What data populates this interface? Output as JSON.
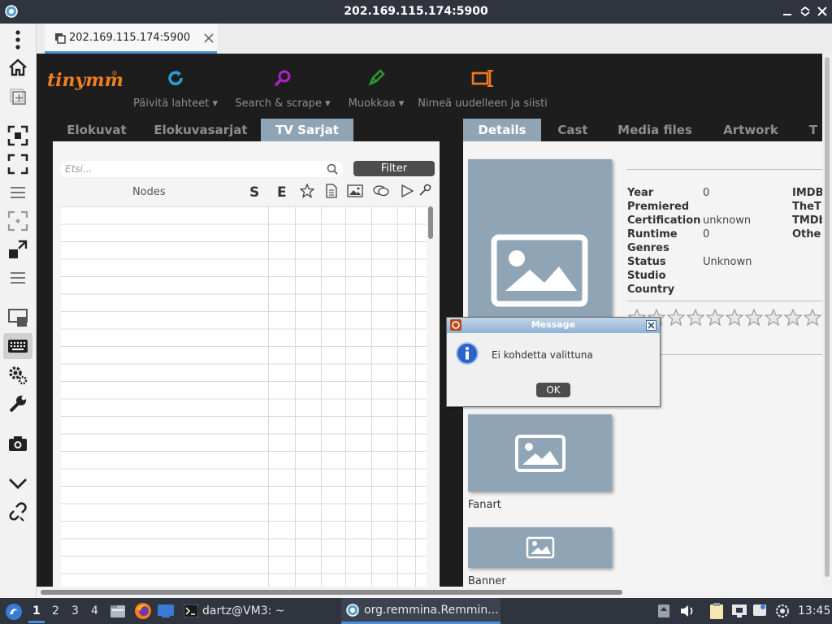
{
  "window": {
    "title": "202.169.115.174:5900"
  },
  "remmina_tab": {
    "label": "202.169.115.174:5900"
  },
  "app": {
    "logo": "tinymm",
    "toolbar": [
      {
        "label": "Päivitä lahteet ▾",
        "icon": "refresh-icon",
        "color": "#2aa0d8"
      },
      {
        "label": "Search & scrape ▾",
        "icon": "search-icon",
        "color": "#b020c8"
      },
      {
        "label": "Muokkaa ▾",
        "icon": "edit-icon",
        "color": "#2a9a2a"
      },
      {
        "label": "Nimeä uudelleen ja siisti",
        "icon": "rename-icon",
        "color": "#f07820"
      }
    ],
    "left_tabs": [
      "Elokuvat",
      "Elokuvasarjat",
      "TV Sarjat"
    ],
    "right_tabs": [
      "Details",
      "Cast",
      "Media files",
      "Artwork",
      "T"
    ],
    "search_placeholder": "Etsi...",
    "filter_label": "Filter",
    "tree_header": {
      "nodes": "Nodes",
      "s": "S",
      "e": "E"
    },
    "details": {
      "fields": [
        {
          "label": "Year",
          "value": "0"
        },
        {
          "label": "Premiered",
          "value": ""
        },
        {
          "label": "Certification",
          "value": "unknown"
        },
        {
          "label": "Runtime",
          "value": "0"
        },
        {
          "label": "Genres",
          "value": ""
        },
        {
          "label": "Status",
          "value": "Unknown"
        },
        {
          "label": "Studio",
          "value": ""
        },
        {
          "label": "Country",
          "value": ""
        }
      ],
      "ids": [
        "IMDB",
        "TheT",
        "TMDb",
        "Othe"
      ],
      "rating_stars": 10,
      "rating_value": 0,
      "fanart_label": "Fanart",
      "banner_label": "Banner"
    }
  },
  "dialog": {
    "title": "Message",
    "message": "Ei kohdetta valittuna",
    "ok_label": "OK"
  },
  "taskbar": {
    "workspaces": [
      "1",
      "2",
      "3",
      "4"
    ],
    "current_workspace": "1",
    "terminal": "dartz@VM3: ~",
    "remmina": "org.remmina.Remmin...",
    "clock": "13:45"
  }
}
